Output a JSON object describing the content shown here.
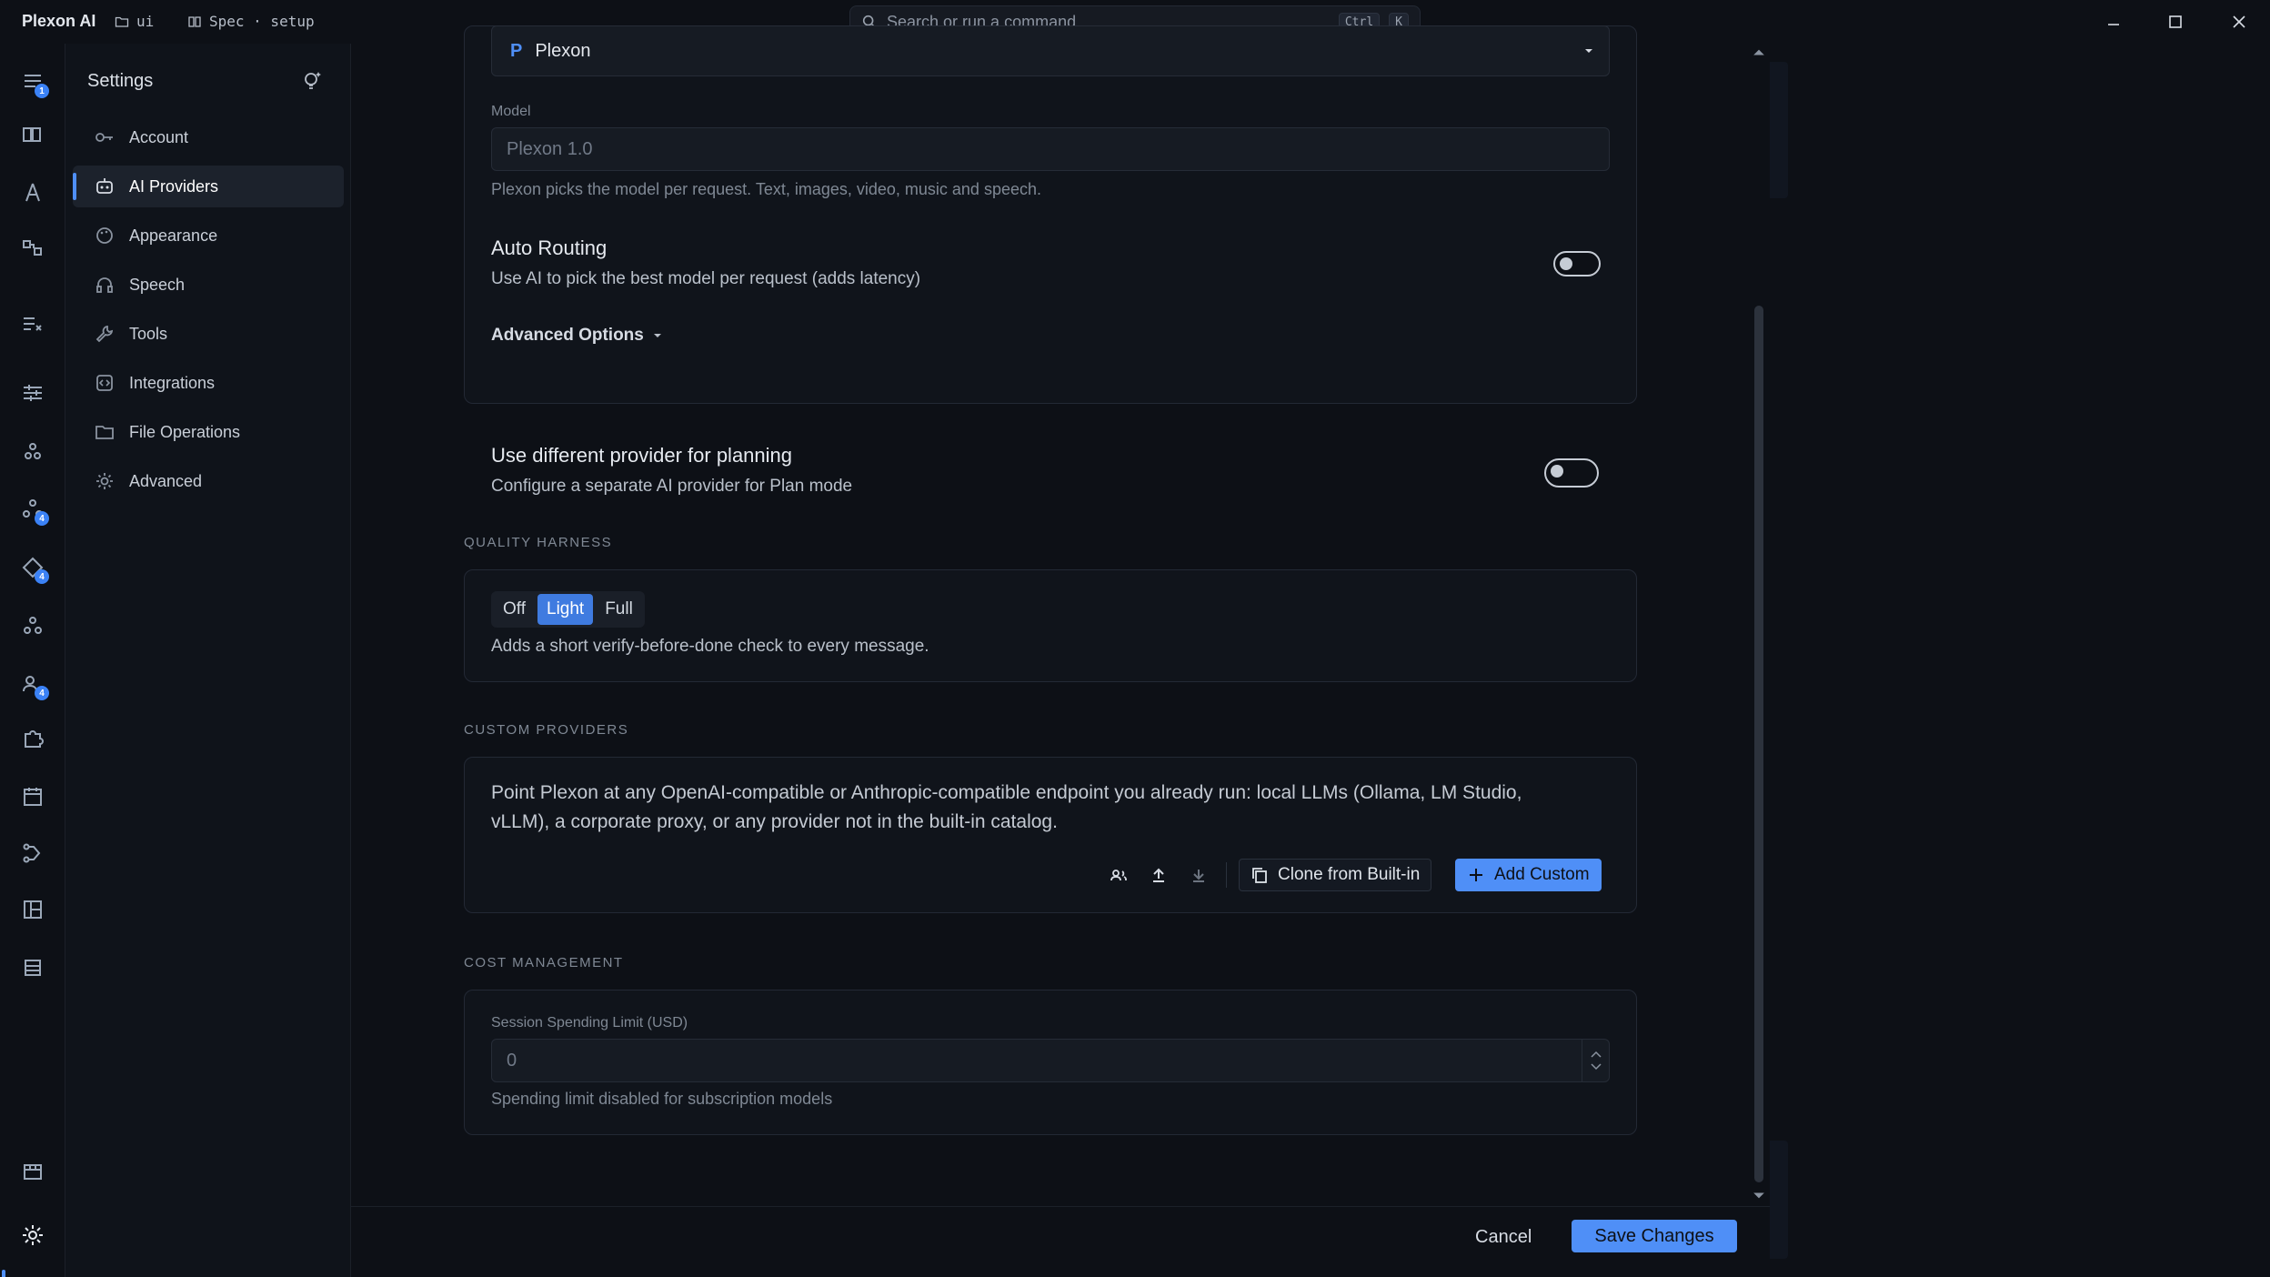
{
  "titlebar": {
    "app_name": "Plexon AI",
    "folder": "ui",
    "spec": "Spec · setup",
    "search_placeholder": "Search or run a command",
    "shortcut_ctrl": "Ctrl",
    "shortcut_key": "K"
  },
  "rail": {
    "badges": [
      "1",
      "4",
      "4",
      "4"
    ]
  },
  "sidebar": {
    "title": "Settings",
    "items": [
      {
        "label": "Account",
        "icon": "key-icon"
      },
      {
        "label": "AI Providers",
        "icon": "robot-icon"
      },
      {
        "label": "Appearance",
        "icon": "palette-icon"
      },
      {
        "label": "Speech",
        "icon": "headphones-icon"
      },
      {
        "label": "Tools",
        "icon": "wrench-icon"
      },
      {
        "label": "Integrations",
        "icon": "plug-icon"
      },
      {
        "label": "File Operations",
        "icon": "folder-icon"
      },
      {
        "label": "Advanced",
        "icon": "gear-icon"
      }
    ],
    "active": "AI Providers"
  },
  "provider": {
    "selected": "Plexon",
    "model_label": "Model",
    "model_value": "Plexon 1.0",
    "model_help": "Plexon picks the model per request. Text, images, video, music and speech.",
    "auto_routing_title": "Auto Routing",
    "auto_routing_desc": "Use AI to pick the best model per request (adds latency)",
    "auto_routing_on": false,
    "advanced_options": "Advanced Options"
  },
  "planning": {
    "title": "Use different provider for planning",
    "desc": "Configure a separate AI provider for Plan mode",
    "enabled": false
  },
  "quality": {
    "section": "QUALITY HARNESS",
    "options": [
      "Off",
      "Light",
      "Full"
    ],
    "selected": "Light",
    "desc": "Adds a short verify-before-done check to every message."
  },
  "custom": {
    "section": "CUSTOM PROVIDERS",
    "desc_line1": "Point Plexon at any OpenAI-compatible or Anthropic-compatible endpoint you already run: local LLMs (Ollama, LM Studio,",
    "desc_line2": "vLLM), a corporate proxy, or any provider not in the built-in catalog.",
    "clone_label": "Clone from Built-in",
    "add_label": "Add Custom"
  },
  "cost": {
    "section": "COST MANAGEMENT",
    "limit_label": "Session Spending Limit (USD)",
    "limit_value": "0",
    "limit_help": "Spending limit disabled for subscription models"
  },
  "footer": {
    "cancel": "Cancel",
    "save": "Save Changes"
  },
  "colors": {
    "accent": "#4f8ff7",
    "background": "#0d1016",
    "card": "#10141b"
  }
}
